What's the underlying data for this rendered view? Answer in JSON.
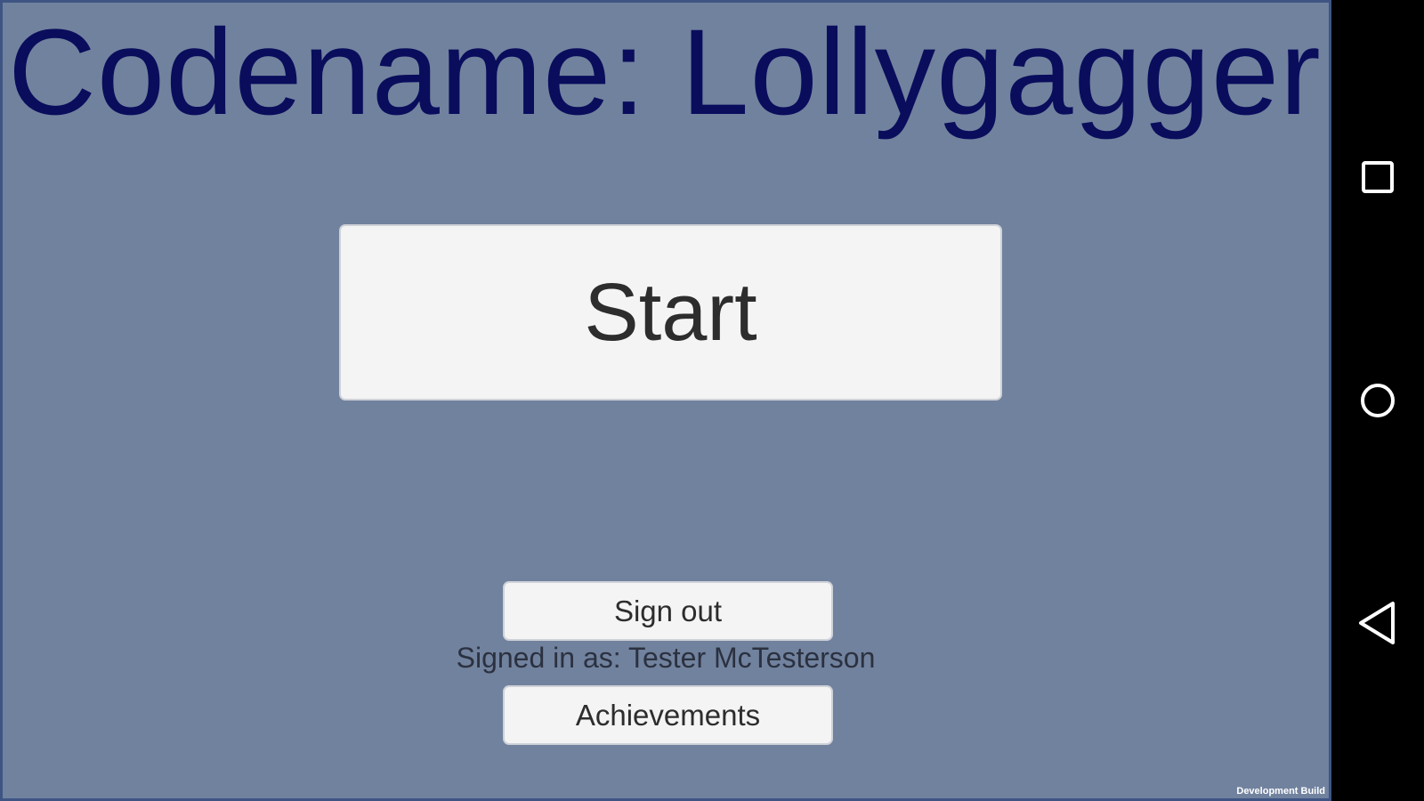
{
  "game": {
    "title": "Codename: Lollygagger",
    "start_label": "Start",
    "sign_out_label": "Sign out",
    "signed_in_text": "Signed in as: Tester McTesterson",
    "achievements_label": "Achievements",
    "dev_build_label": "Development Build"
  },
  "nav_bar": {
    "items": [
      {
        "name": "recents",
        "icon": "square-icon"
      },
      {
        "name": "home",
        "icon": "circle-icon"
      },
      {
        "name": "back",
        "icon": "triangle-back-icon"
      }
    ]
  },
  "colors": {
    "background": "#71829e",
    "title": "#0a0d5c",
    "button_bg": "#f4f4f4",
    "button_text": "#2d2d2d",
    "nav_bar": "#000000"
  }
}
